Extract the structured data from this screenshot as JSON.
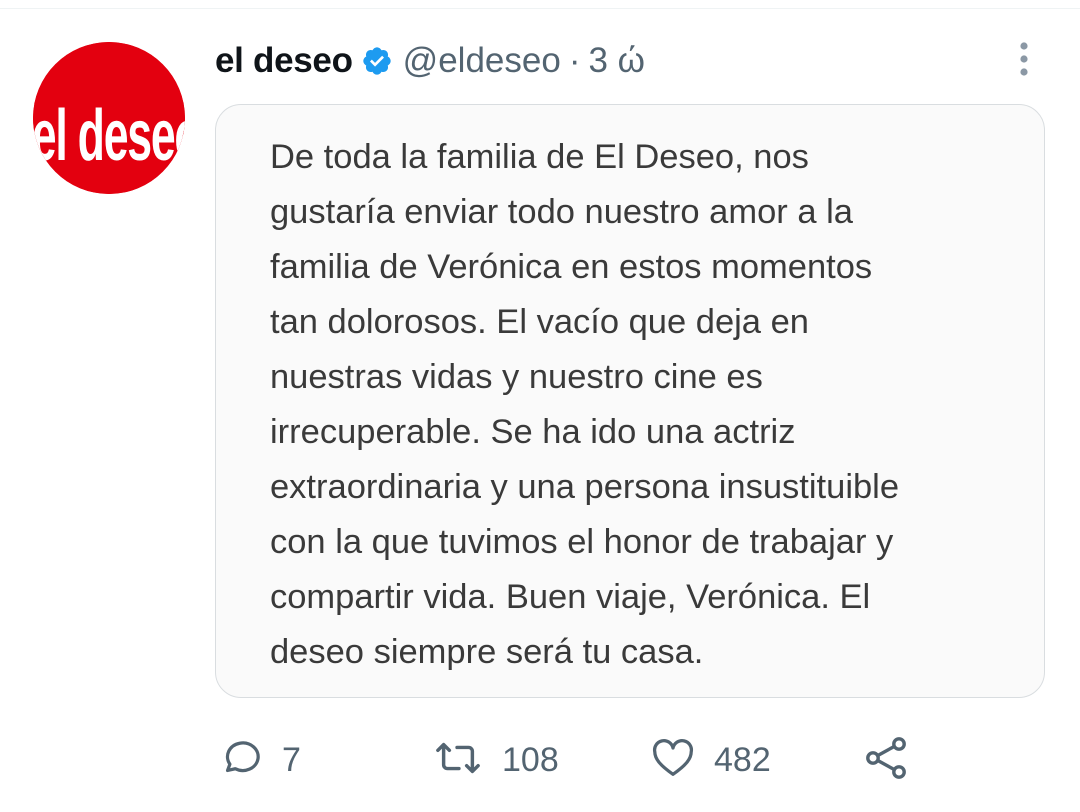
{
  "tweet": {
    "display_name": "el deseo",
    "handle": "@eldeseo",
    "separator": "·",
    "time": "3 ώ",
    "avatar": {
      "logo_text": "el deseo",
      "background": "#e3000f"
    },
    "verified_color": "#1d9bf0",
    "body": "De toda la familia de El Deseo, nos\ngustaría enviar todo nuestro amor a la\nfamilia de Verónica en estos momentos\ntan dolorosos. El vacío que deja en\nnuestras vidas y nuestro cine es\nirrecuperable. Se ha ido una actriz\nextraordinaria y una persona insustituible\ncon la que tuvimos el honor de trabajar y\ncompartir vida. Buen viaje, Verónica. El\ndeseo siempre será tu casa."
  },
  "actions": {
    "replies": "7",
    "retweets": "108",
    "likes": "482",
    "icons": [
      "reply-icon",
      "retweet-icon",
      "like-icon",
      "share-icon",
      "more-icon"
    ]
  }
}
